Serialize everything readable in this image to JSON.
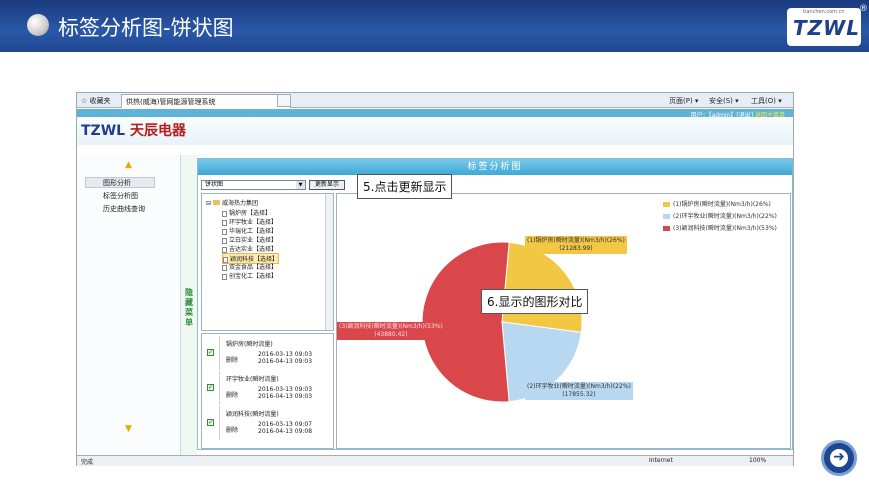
{
  "slide": {
    "title": "标签分析图-饼状图"
  },
  "brand": {
    "logo": "TZWL",
    "site": "tianchen.com.cn",
    "reg": "®"
  },
  "browser": {
    "favorites": "☆ 收藏夹",
    "tab_title": "供热(威海)管网能源管理系统",
    "toolbar": [
      "页面(P) ▾",
      "安全(S) ▾",
      "工具(O) ▾"
    ],
    "status_left": "完成",
    "status_zone": "Internet",
    "zoom": "100%"
  },
  "app": {
    "logo_mark": "TZWL",
    "logo_name": "天辰电器",
    "user": "用户：【admin】[退出]",
    "exit_label": "返回主菜单",
    "hide_menu": "隐藏菜单"
  },
  "nav": {
    "items": [
      "图形分析",
      "标签分析图",
      "历史曲线查询"
    ]
  },
  "panel": {
    "title": "标签分析图",
    "chart_type_value": "饼状图",
    "update_button": "更新显示"
  },
  "tree": {
    "root": "威海热力集团",
    "items": [
      "锅炉房【选择】",
      "环宇牧业【选择】",
      "华瑞化工【选择】",
      "立白实业【选择】",
      "吉达实业【选择】",
      "颖润科技【选择】",
      "双金食品【选择】",
      "创宝化工【选择】"
    ]
  },
  "selected": [
    {
      "name": "锅炉房(瞬时流量)",
      "action": "删除",
      "t1": "2016-03-13 09:03",
      "t2": "2016-04-13 09:03"
    },
    {
      "name": "环宇牧业(瞬时流量)",
      "action": "删除",
      "t1": "2016-03-13 09:03",
      "t2": "2016-04-13 09:03"
    },
    {
      "name": "颖润科技(瞬时流量)",
      "action": "删除",
      "t1": "2016-03-13 09:07",
      "t2": "2016-04-13 09:08"
    }
  ],
  "callouts": {
    "step5": "5.点击更新显示",
    "step6": "6.显示的图形对比"
  },
  "chart_data": {
    "type": "pie",
    "series": [
      {
        "name": "(1)锅炉房(瞬时流量)(Nm3/h)(26%)",
        "value": 21283.99,
        "percent": 26,
        "color": "#f2c744",
        "label": "(1)锅炉房(瞬时流量)(Nm3/h)(26%)",
        "value_label": "(21283.99)"
      },
      {
        "name": "(2)环宇牧业(瞬时流量)(Nm3/h)(22%)",
        "value": 17855.32,
        "percent": 22,
        "color": "#b8d8f2",
        "label": "(2)环宇牧业(瞬时流量)(Nm3/h)(22%)",
        "value_label": "(17855.32)"
      },
      {
        "name": "(3)颖润科技(瞬时流量)(Nm3/h)(53%)",
        "value": 43880.42,
        "percent": 53,
        "color": "#d9474b",
        "label": "(3)颖润科技(瞬时流量)(Nm3/h)(53%)",
        "value_label": "(43880.42)"
      }
    ],
    "legend_position": "top-right"
  }
}
